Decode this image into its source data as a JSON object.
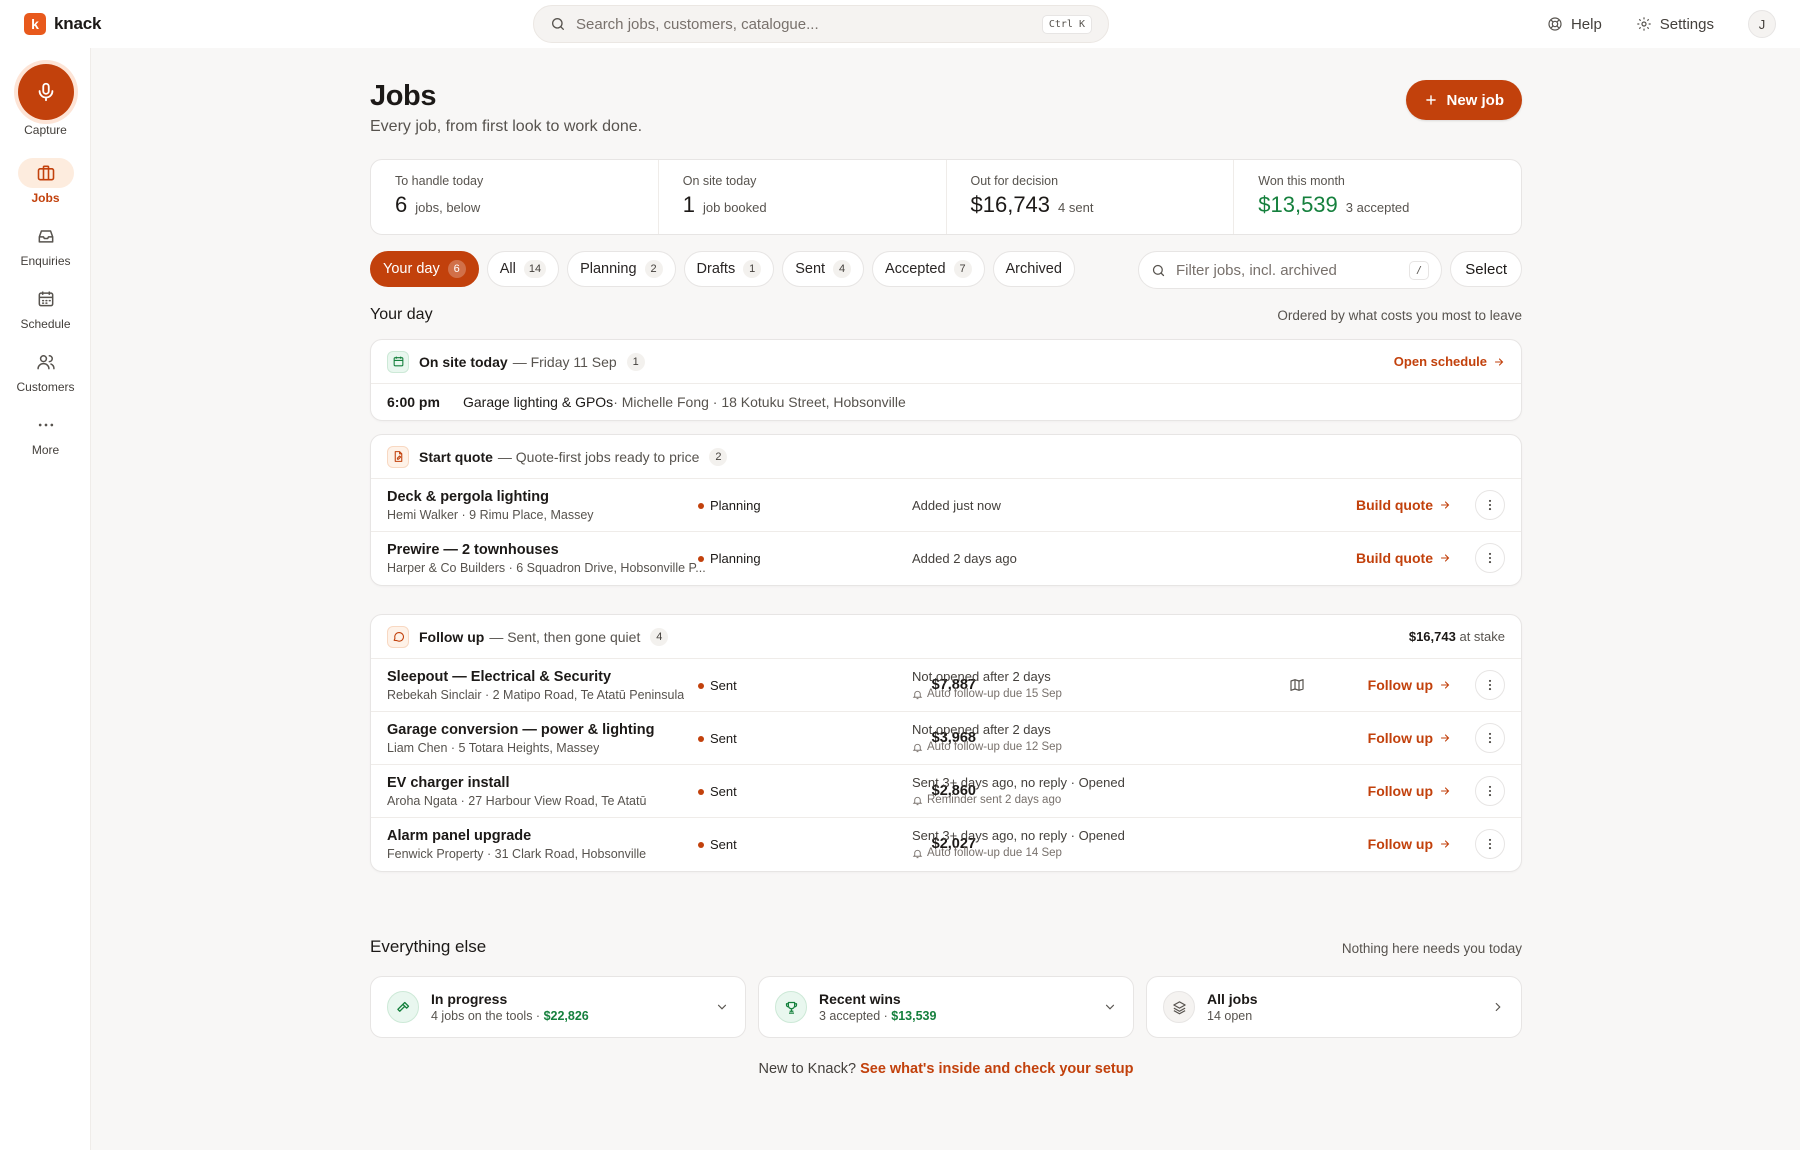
{
  "brand": {
    "logo_letter": "k",
    "name": "knack",
    "accent": "#c2410c"
  },
  "search": {
    "placeholder": "Search jobs, customers, catalogue...",
    "shortcut": "Ctrl K"
  },
  "topnav": {
    "help": "Help",
    "settings": "Settings",
    "avatar": "J"
  },
  "sidebar": {
    "capture": "Capture",
    "items": [
      {
        "label": "Jobs",
        "icon": "briefcase-icon",
        "active": true
      },
      {
        "label": "Enquiries",
        "icon": "inbox-icon"
      },
      {
        "label": "Schedule",
        "icon": "calendar-icon"
      },
      {
        "label": "Customers",
        "icon": "users-icon"
      },
      {
        "label": "More",
        "icon": "more-icon"
      }
    ]
  },
  "page": {
    "title": "Jobs",
    "subtitle": "Every job, from first look to work done.",
    "new_job": "New job"
  },
  "stats": [
    {
      "label": "To handle today",
      "value": "6",
      "note": "jobs, below"
    },
    {
      "label": "On site today",
      "value": "1",
      "note": "job booked"
    },
    {
      "label": "Out for decision",
      "value": "$16,743",
      "note": "4 sent"
    },
    {
      "label": "Won this month",
      "value": "$13,539",
      "note": "3 accepted",
      "color": "#15803d"
    }
  ],
  "tabs": [
    {
      "label": "Your day",
      "count": "6",
      "active": true
    },
    {
      "label": "All",
      "count": "14"
    },
    {
      "label": "Planning",
      "count": "2"
    },
    {
      "label": "Drafts",
      "count": "1"
    },
    {
      "label": "Sent",
      "count": "4"
    },
    {
      "label": "Accepted",
      "count": "7"
    },
    {
      "label": "Archived",
      "count": ""
    }
  ],
  "filter": {
    "placeholder": "Filter jobs, incl. archived",
    "shortcut": "/"
  },
  "select_label": "Select",
  "your_day": {
    "title": "Your day",
    "note": "Ordered by what costs you most to leave"
  },
  "onsite": {
    "title": "On site today",
    "desc": "— Friday 11 Sep",
    "count": "1",
    "link": "Open schedule",
    "visit": {
      "time": "6:00 pm",
      "title": "Garage lighting & GPOs",
      "detail": " · Michelle Fong · 18 Kotuku Street, Hobsonville"
    }
  },
  "start_quote": {
    "title": "Start quote",
    "desc": "— Quote-first jobs ready to price",
    "count": "2",
    "rows": [
      {
        "title": "Deck & pergola lighting",
        "sub": "Hemi Walker · 9 Rimu Place, Massey",
        "status": "Planning",
        "note": "Added just now",
        "action": "Build quote"
      },
      {
        "title": "Prewire — 2 townhouses",
        "sub": "Harper & Co Builders · 6 Squadron Drive, Hobsonville P...",
        "status": "Planning",
        "note": "Added 2 days ago",
        "action": "Build quote"
      }
    ]
  },
  "follow_up": {
    "title": "Follow up",
    "desc": "— Sent, then gone quiet",
    "count": "4",
    "stake_value": "$16,743",
    "stake_label": "at stake",
    "rows": [
      {
        "title": "Sleepout — Electrical & Security",
        "sub": "Rebekah Sinclair · 2 Matipo Road, Te Atatū Peninsula",
        "status": "Sent",
        "amount": "$7,887",
        "note1": "Not opened after 2 days",
        "note2": "Auto follow-up due 15 Sep",
        "action": "Follow up"
      },
      {
        "title": "Garage conversion — power & lighting",
        "sub": "Liam Chen · 5 Totara Heights, Massey",
        "status": "Sent",
        "amount": "$3,968",
        "note1": "Not opened after 2 days",
        "note2": "Auto follow-up due 12 Sep",
        "action": "Follow up"
      },
      {
        "title": "EV charger install",
        "sub": "Aroha Ngata · 27 Harbour View Road, Te Atatū",
        "status": "Sent",
        "amount": "$2,860",
        "note1": "Sent 3+ days ago, no reply · Opened",
        "note2": "Reminder sent 2 days ago",
        "action": "Follow up"
      },
      {
        "title": "Alarm panel upgrade",
        "sub": "Fenwick Property · 31 Clark Road, Hobsonville",
        "status": "Sent",
        "amount": "$2,027",
        "note1": "Sent 3+ days ago, no reply · Opened",
        "note2": "Auto follow-up due 14 Sep",
        "action": "Follow up"
      }
    ]
  },
  "everything_else": {
    "title": "Everything else",
    "note": "Nothing here needs you today",
    "cards": [
      {
        "title": "In progress",
        "sub": "4 jobs on the tools · ",
        "sub_value": "$22,826",
        "icon": "hammer-icon"
      },
      {
        "title": "Recent wins",
        "sub": "3 accepted · ",
        "sub_value": "$13,539",
        "icon": "trophy-icon"
      },
      {
        "title": "All jobs",
        "sub": "14 open",
        "sub_value": "",
        "icon": "layers-icon"
      }
    ]
  },
  "footer": {
    "text": "New to Knack? ",
    "link": "See what's inside and check your setup"
  }
}
